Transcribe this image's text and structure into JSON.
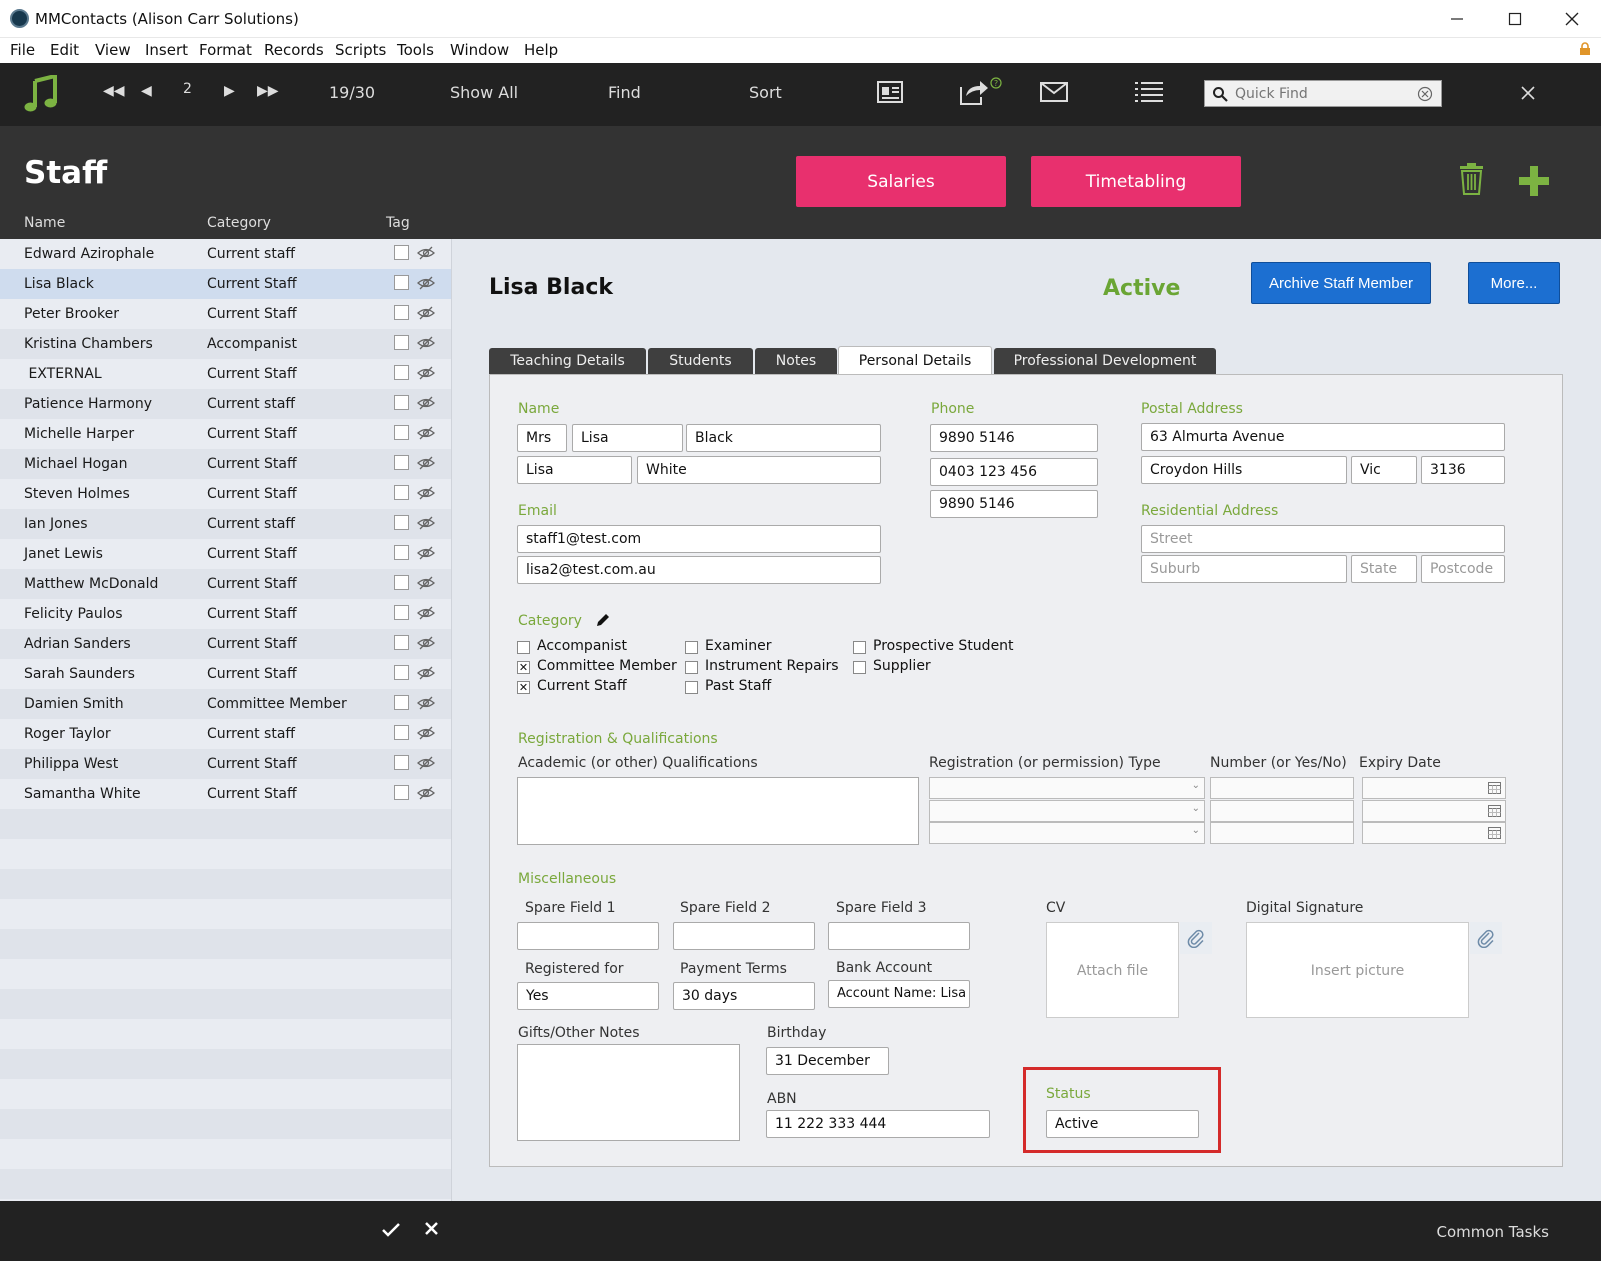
{
  "window": {
    "title": "MMContacts (Alison Carr Solutions)",
    "minimize_icon": "minimize-icon",
    "maximize_icon": "maximize-icon",
    "close_icon": "close-icon"
  },
  "menu": [
    "File",
    "Edit",
    "View",
    "Insert",
    "Format",
    "Records",
    "Scripts",
    "Tools",
    "Window",
    "Help"
  ],
  "toolbar": {
    "current_record": "2",
    "record_count": "19/30",
    "show_all": "Show All",
    "find": "Find",
    "sort": "Sort",
    "quick_find_placeholder": "Quick Find"
  },
  "header": {
    "title": "Staff",
    "salaries": "Salaries",
    "timetabling": "Timetabling"
  },
  "list": {
    "columns": [
      "Name",
      "Category",
      "Tag"
    ],
    "rows": [
      {
        "name": "Edward Azirophale",
        "category": "Current staff"
      },
      {
        "name": "Lisa Black",
        "category": "Current Staff"
      },
      {
        "name": "Peter Brooker",
        "category": "Current Staff"
      },
      {
        "name": "Kristina Chambers",
        "category": "Accompanist"
      },
      {
        "name": " EXTERNAL",
        "category": "Current Staff"
      },
      {
        "name": "Patience Harmony",
        "category": "Current staff"
      },
      {
        "name": "Michelle Harper",
        "category": "Current Staff"
      },
      {
        "name": "Michael Hogan",
        "category": "Current Staff"
      },
      {
        "name": "Steven Holmes",
        "category": "Current Staff"
      },
      {
        "name": "Ian Jones",
        "category": "Current staff"
      },
      {
        "name": "Janet Lewis",
        "category": "Current Staff"
      },
      {
        "name": "Matthew McDonald",
        "category": "Current Staff"
      },
      {
        "name": "Felicity Paulos",
        "category": "Current Staff"
      },
      {
        "name": "Adrian Sanders",
        "category": "Current Staff"
      },
      {
        "name": "Sarah Saunders",
        "category": "Current Staff"
      },
      {
        "name": "Damien Smith",
        "category": "Committee Member"
      },
      {
        "name": "Roger Taylor",
        "category": "Current staff"
      },
      {
        "name": "Philippa West",
        "category": "Current Staff"
      },
      {
        "name": "Samantha White",
        "category": "Current Staff"
      }
    ],
    "selected_index": 1
  },
  "record": {
    "name": "Lisa Black",
    "status_badge": "Active",
    "archive_button": "Archive Staff Member",
    "more_button": "More..."
  },
  "tabs": [
    "Teaching Details",
    "Students",
    "Notes",
    "Personal Details",
    "Professional Development"
  ],
  "active_tab": "Personal Details",
  "form": {
    "name_label": "Name",
    "title": "Mrs",
    "first_name": "Lisa",
    "last_name": "Black",
    "preferred_name": "Lisa",
    "other_name": "White",
    "phone_label": "Phone",
    "phone1": "9890 5146",
    "phone2": "0403 123 456",
    "phone3": "9890 5146",
    "postal_label": "Postal Address",
    "postal_street": "63 Almurta Avenue",
    "postal_suburb": "Croydon Hills",
    "postal_state": "Vic",
    "postal_postcode": "3136",
    "residential_label": "Residential Address",
    "res_street_ph": "Street",
    "res_suburb_ph": "Suburb",
    "res_state_ph": "State",
    "res_postcode_ph": "Postcode",
    "email_label": "Email",
    "email1": "staff1@test.com",
    "email2": "lisa2@test.com.au",
    "category_label": "Category",
    "categories": [
      {
        "label": "Accompanist",
        "checked": false
      },
      {
        "label": "Committee Member",
        "checked": true
      },
      {
        "label": "Current Staff",
        "checked": true
      },
      {
        "label": "Examiner",
        "checked": false
      },
      {
        "label": "Instrument Repairs",
        "checked": false
      },
      {
        "label": "Past Staff",
        "checked": false
      },
      {
        "label": "Prospective Student",
        "checked": false
      },
      {
        "label": "Supplier",
        "checked": false
      }
    ],
    "reg_label": "Registration & Qualifications",
    "academic_label": "Academic (or other) Qualifications",
    "reg_type_label": "Registration (or permission) Type",
    "number_label": "Number (or Yes/No)",
    "expiry_label": "Expiry Date",
    "misc_label": "Miscellaneous",
    "spare1_label": "Spare Field 1",
    "spare2_label": "Spare Field 2",
    "spare3_label": "Spare Field 3",
    "registered_for_label": "Registered for",
    "registered_for": "Yes",
    "payment_terms_label": "Payment Terms",
    "payment_terms": "30 days",
    "bank_account_label": "Bank Account",
    "bank_account": "Account Name: Lisa",
    "cv_label": "CV",
    "cv_placeholder": "Attach file",
    "signature_label": "Digital Signature",
    "signature_placeholder": "Insert picture",
    "gifts_label": "Gifts/Other Notes",
    "birthday_label": "Birthday",
    "birthday": "31 December",
    "abn_label": "ABN",
    "abn": "11 222 333 444",
    "status_label": "Status",
    "status": "Active"
  },
  "footer": {
    "common_tasks": "Common Tasks"
  },
  "colors": {
    "accent_pink": "#e8306e",
    "accent_blue": "#1c6fd1",
    "active_green": "#6aa534",
    "highlight_red": "#d42a2a"
  }
}
